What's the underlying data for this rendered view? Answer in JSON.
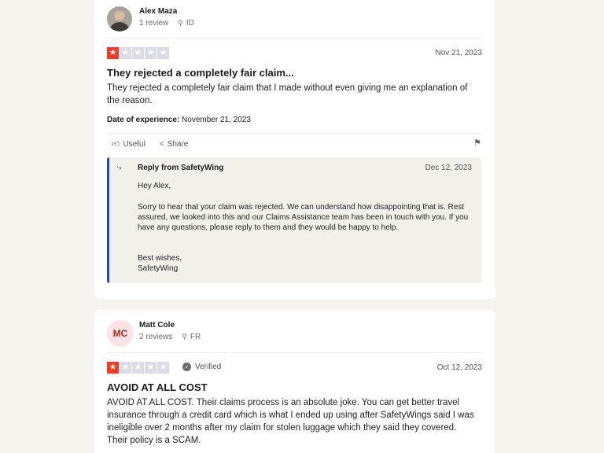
{
  "review1": {
    "reviewer_name": "Alex Maza",
    "review_count": "1 review",
    "country": "ID",
    "rating": 1,
    "date": "Nov 21, 2023",
    "title": "They rejected a completely fair claim...",
    "body": "They rejected a completely fair claim that I made without even giving me an explanation of the reason.",
    "experience_label": "Date of experience:",
    "experience_date": "November 21, 2023",
    "useful_label": "Useful",
    "share_label": "Share",
    "reply": {
      "from": "Reply from SafetyWing",
      "date": "Dec 12, 2023",
      "greeting": "Hey Alex,",
      "message": "Sorry to hear that your claim was rejected. We can understand how disappointing that is. Rest assured, we looked into this and our Claims Assistance team has been in touch with you. If you have any questions, please reply to them and they would be happy to help.",
      "signoff": "Best wishes,",
      "signature": "SafetyWing"
    }
  },
  "review2": {
    "avatar_initials": "MC",
    "reviewer_name": "Matt Cole",
    "review_count": "2 reviews",
    "country": "FR",
    "rating": 1,
    "verified_label": "Verified",
    "date": "Oct 12, 2023",
    "title": "AVOID AT ALL COST",
    "body": "AVOID AT ALL COST. Their claims process is an absolute joke. You can get better travel insurance through a credit card which is what I ended up using after SafetyWings said I was ineligible over 2 months after my claim for stolen luggage which they said they covered. Their policy is a SCAM."
  },
  "icons": {
    "location": "location-pin-icon",
    "star": "star-icon",
    "thumbs_up": "thumbs-up-icon",
    "share": "share-icon",
    "flag": "flag-icon",
    "reply": "reply-arrow-icon",
    "verified": "verified-check-icon"
  },
  "colors": {
    "star_filled": "#ff3722",
    "star_empty": "#dcdce6",
    "reply_accent": "#1a47c9",
    "avatar_initials_bg": "#fde3e5",
    "page_bg": "#f5f4ef"
  }
}
